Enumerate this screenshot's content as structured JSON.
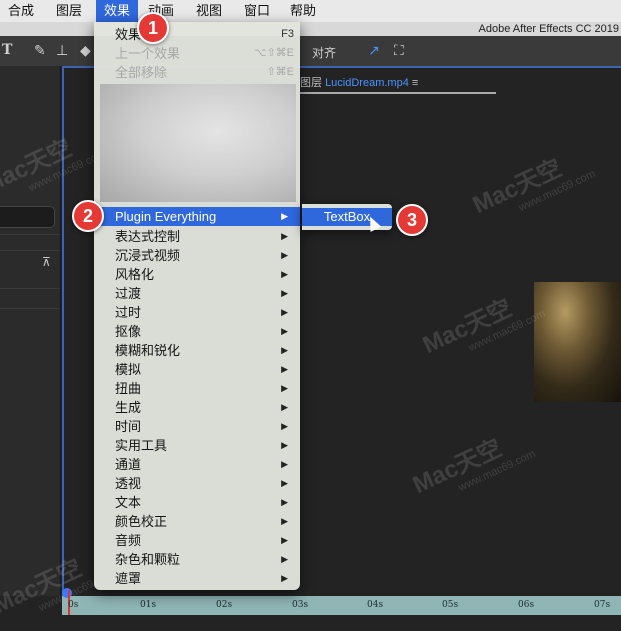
{
  "menubar": {
    "items": [
      "合成",
      "图层",
      "效果",
      "动画",
      "视图",
      "窗口",
      "帮助"
    ],
    "active": "效果"
  },
  "app_title": "Adobe After Effects CC 2019",
  "toolbar": {
    "align_label": "对齐"
  },
  "comp_tab": {
    "prefix": "图层",
    "name": "LucidDream.mp4",
    "menu_glyph": "≡"
  },
  "effects_menu": {
    "top_items": [
      {
        "label": "效果控件",
        "shortcut": "F3",
        "disabled": false
      },
      {
        "label": "上一个效果",
        "shortcut": "⌥⇧⌘E",
        "disabled": true
      },
      {
        "label": "全部移除",
        "shortcut": "⇧⌘E",
        "disabled": true
      }
    ],
    "highlighted": "Plugin Everything",
    "categories": [
      "表达式控制",
      "沉浸式视频",
      "风格化",
      "过渡",
      "过时",
      "抠像",
      "模糊和锐化",
      "模拟",
      "扭曲",
      "生成",
      "时间",
      "实用工具",
      "通道",
      "透视",
      "文本",
      "颜色校正",
      "音频",
      "杂色和颗粒",
      "遮罩"
    ],
    "submenu_arrow": "▶"
  },
  "submenu": {
    "item": "TextBox"
  },
  "badges": [
    "1",
    "2",
    "3"
  ],
  "timeline": {
    "ticks": [
      "0s",
      "01s",
      "02s",
      "03s",
      "04s",
      "05s",
      "06s",
      "07s"
    ],
    "current_time_fraction": 0
  },
  "watermark": {
    "text": "Mac天空",
    "url": "www.mac69.com"
  },
  "colors": {
    "menu_highlight": "#2f67dd",
    "badge": "#e53935",
    "panel_focus": "#3d63b2",
    "timeline": "#8fb5b5"
  }
}
